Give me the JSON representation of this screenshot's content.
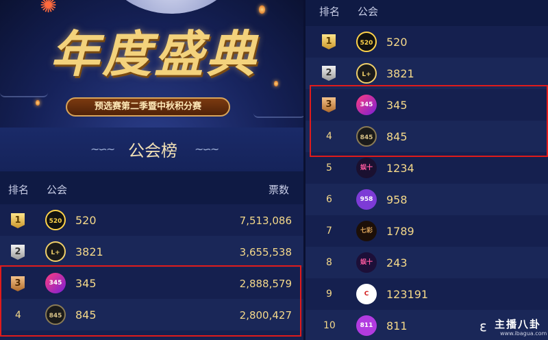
{
  "banner": {
    "title": "年度盛典",
    "subtitle": "预选赛第二季暨中秋积分赛"
  },
  "board": {
    "title": "公会榜"
  },
  "left_table": {
    "headers": {
      "rank": "排名",
      "guild": "公会",
      "votes": "票数"
    },
    "rows": [
      {
        "rank": "1",
        "badge": "gold",
        "avatar_text": "520",
        "name": "520",
        "votes": "7,513,086"
      },
      {
        "rank": "2",
        "badge": "silver",
        "avatar_text": "L+",
        "name": "3821",
        "votes": "3,655,538"
      },
      {
        "rank": "3",
        "badge": "bronze",
        "avatar_text": "345",
        "name": "345",
        "votes": "2,888,579"
      },
      {
        "rank": "4",
        "badge": "",
        "avatar_text": "845",
        "name": "845",
        "votes": "2,800,427"
      }
    ]
  },
  "right_table": {
    "headers": {
      "rank": "排名",
      "guild": "公会"
    },
    "rows": [
      {
        "rank": "1",
        "badge": "gold",
        "avatar_text": "520",
        "name": "520"
      },
      {
        "rank": "2",
        "badge": "silver",
        "avatar_text": "L+",
        "name": "3821"
      },
      {
        "rank": "3",
        "badge": "bronze",
        "avatar_text": "345",
        "name": "345"
      },
      {
        "rank": "4",
        "badge": "",
        "avatar_text": "845",
        "name": "845"
      },
      {
        "rank": "5",
        "badge": "",
        "avatar_text": "娱十",
        "name": "1234"
      },
      {
        "rank": "6",
        "badge": "",
        "avatar_text": "958",
        "name": "958"
      },
      {
        "rank": "7",
        "badge": "",
        "avatar_text": "七彩",
        "name": "1789"
      },
      {
        "rank": "8",
        "badge": "",
        "avatar_text": "娱十",
        "name": "243"
      },
      {
        "rank": "9",
        "badge": "",
        "avatar_text": "C",
        "name": "123191"
      },
      {
        "rank": "10",
        "badge": "",
        "avatar_text": "811",
        "name": "811"
      }
    ]
  },
  "watermark": {
    "text": "主播八卦",
    "url": "www.ibagua.com"
  },
  "colors": {
    "highlight": "#e01b1b",
    "gold_text": "#f5d98a",
    "background": "#15204f"
  }
}
